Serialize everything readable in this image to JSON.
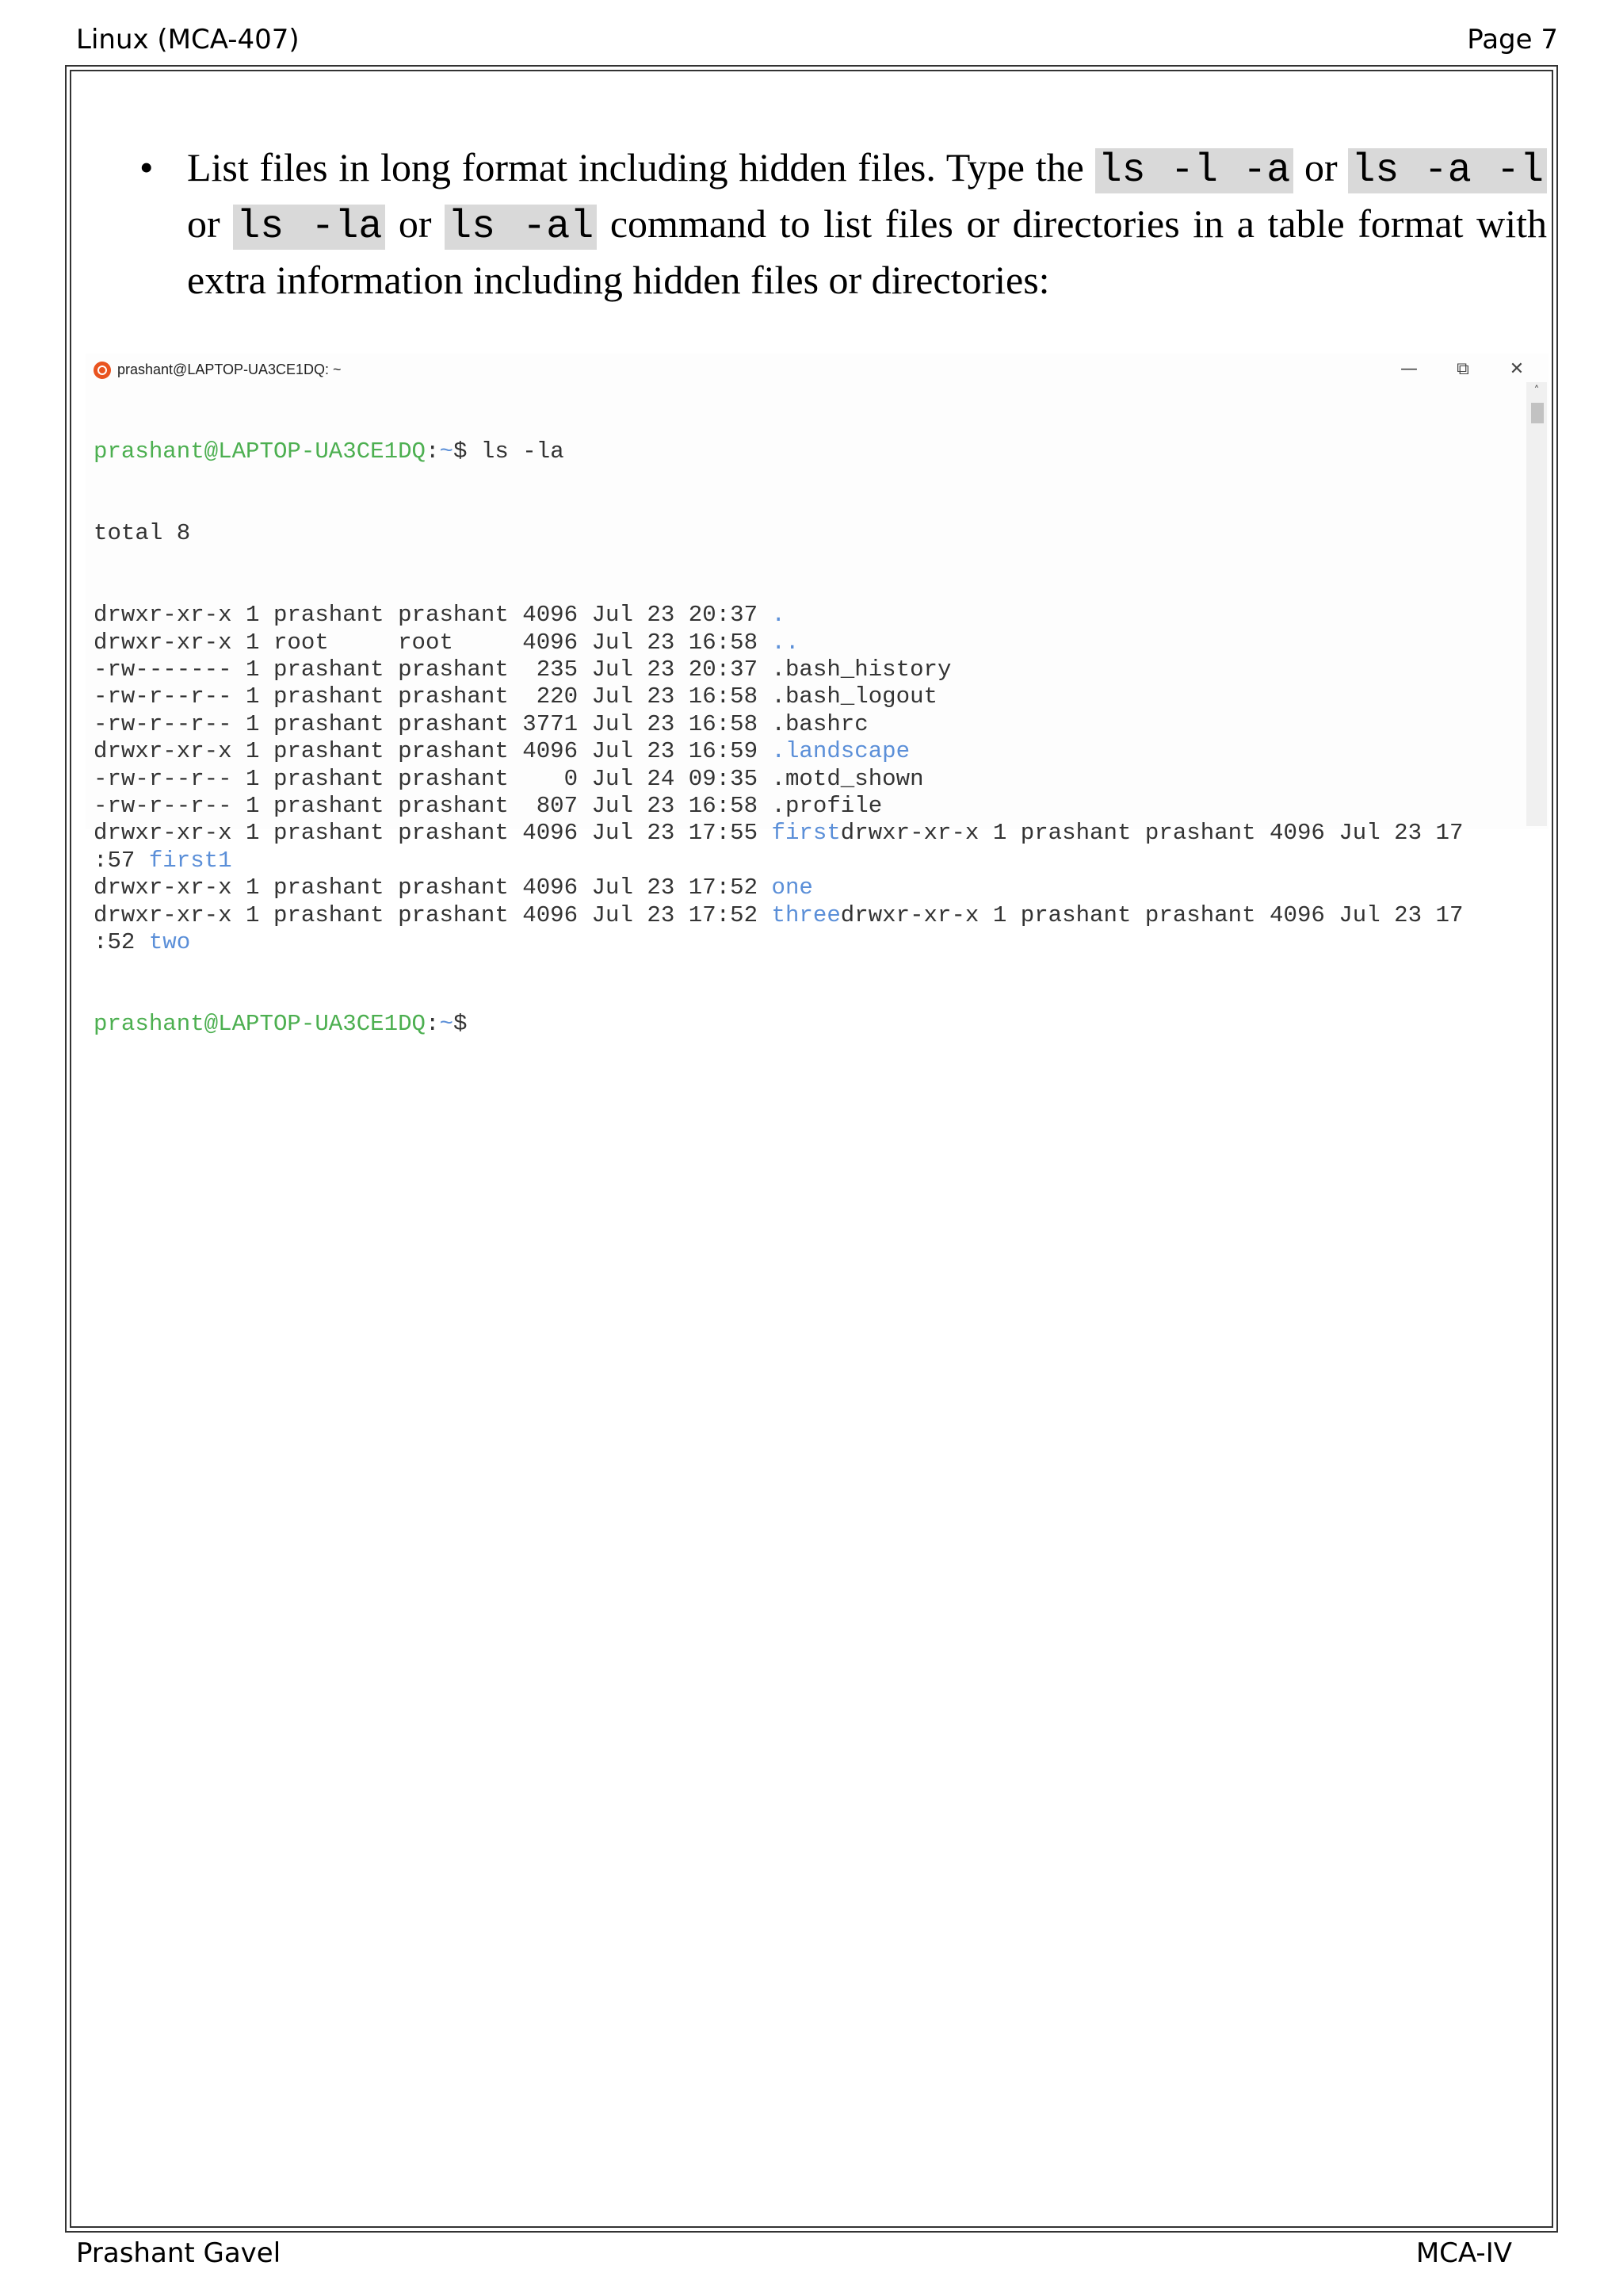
{
  "header": {
    "left": "Linux (MCA-407)",
    "right": "Page 7"
  },
  "footer": {
    "left": "Prashant Gavel",
    "right": "MCA-IV"
  },
  "bullet": {
    "symbol": "•",
    "text_1": "List files in long format including hidden files. Type the ",
    "code_1": "ls -l -a",
    "text_2": " or ",
    "code_2": "ls -a -l",
    "text_3": " or ",
    "code_3": "ls -la",
    "text_4": " or ",
    "code_4": "ls -al",
    "text_5": " command to list files or directories in a table format with extra information including hidden files or directories:"
  },
  "terminal": {
    "icon": "ubuntu-icon",
    "title": "prashant@LAPTOP-UA3CE1DQ: ~",
    "minimize": "—",
    "maximize": "⧉",
    "close": "✕",
    "scroll_up": "˄",
    "prompt_user": "prashant@LAPTOP-UA3CE1DQ",
    "prompt_sep": ":",
    "prompt_path": "~",
    "prompt_dollar": "$",
    "command": " ls -la",
    "total": "total 8",
    "rows": [
      {
        "meta": "drwxr-xr-x 1 prashant prashant 4096 Jul 23 20:37 ",
        "name": ".",
        "name_color": "blue",
        "tail": ""
      },
      {
        "meta": "drwxr-xr-x 1 root     root     4096 Jul 23 16:58 ",
        "name": "..",
        "name_color": "blue",
        "tail": ""
      },
      {
        "meta": "-rw------- 1 prashant prashant  235 Jul 23 20:37 ",
        "name": ".bash_history",
        "name_color": "plain",
        "tail": ""
      },
      {
        "meta": "-rw-r--r-- 1 prashant prashant  220 Jul 23 16:58 ",
        "name": ".bash_logout",
        "name_color": "plain",
        "tail": ""
      },
      {
        "meta": "-rw-r--r-- 1 prashant prashant 3771 Jul 23 16:58 ",
        "name": ".bashrc",
        "name_color": "plain",
        "tail": ""
      },
      {
        "meta": "drwxr-xr-x 1 prashant prashant 4096 Jul 23 16:59 ",
        "name": ".landscape",
        "name_color": "blue",
        "tail": ""
      },
      {
        "meta": "-rw-r--r-- 1 prashant prashant    0 Jul 24 09:35 ",
        "name": ".motd_shown",
        "name_color": "plain",
        "tail": ""
      },
      {
        "meta": "-rw-r--r-- 1 prashant prashant  807 Jul 23 16:58 ",
        "name": ".profile",
        "name_color": "plain",
        "tail": ""
      },
      {
        "meta": "drwxr-xr-x 1 prashant prashant 4096 Jul 23 17:55 ",
        "name": "first",
        "name_color": "blue",
        "tail": "drwxr-xr-x 1 prashant prashant 4096 Jul 23 17"
      },
      {
        "meta": ":57 ",
        "name": "first1",
        "name_color": "blue",
        "tail": ""
      },
      {
        "meta": "drwxr-xr-x 1 prashant prashant 4096 Jul 23 17:52 ",
        "name": "one",
        "name_color": "blue",
        "tail": ""
      },
      {
        "meta": "drwxr-xr-x 1 prashant prashant 4096 Jul 23 17:52 ",
        "name": "three",
        "name_color": "blue",
        "tail": "drwxr-xr-x 1 prashant prashant 4096 Jul 23 17"
      },
      {
        "meta": ":52 ",
        "name": "two",
        "name_color": "blue",
        "tail": ""
      }
    ]
  }
}
